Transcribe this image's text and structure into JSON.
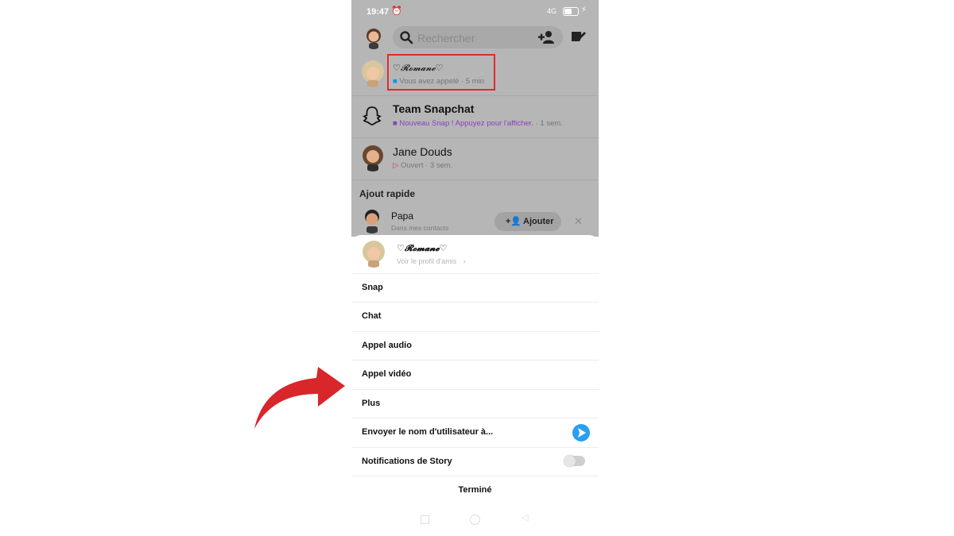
{
  "status_bar": {
    "time": "19:47",
    "signal": "4G",
    "battery_percent": 50
  },
  "search": {
    "placeholder": "Rechercher"
  },
  "chats": [
    {
      "name": "♡𝓡𝓸𝓶𝓪𝓷𝓮♡",
      "status": "Vous avez appelé",
      "time": "5 min",
      "status_icon": "video-call-icon",
      "status_color": "#1d8fe0"
    },
    {
      "name": "Team Snapchat",
      "status": "Nouveau Snap ! Appuyez pour l'afficher.",
      "time": "1 sem.",
      "status_icon": "new-snap-square-icon",
      "status_color": "#8a3fbf"
    },
    {
      "name": "Jane Douds",
      "status": "Ouvert",
      "time": "3 sem.",
      "status_icon": "opened-arrow-icon",
      "status_color": "#e0394a"
    }
  ],
  "quick_add": {
    "title": "Ajout rapide",
    "items": [
      {
        "name": "Papa",
        "subtitle": "Dans mes contacts",
        "add_label": "Ajouter"
      }
    ]
  },
  "sheet": {
    "profile_name": "♡𝓡𝓸𝓶𝓪𝓷𝓮♡",
    "profile_link": "Voir le profil d'amis",
    "items": {
      "snap": "Snap",
      "chat": "Chat",
      "audio": "Appel audio",
      "video": "Appel vidéo",
      "more": "Plus",
      "send_username": "Envoyer le nom d'utilisateur à...",
      "story_notifications": "Notifications de Story",
      "done": "Terminé"
    },
    "story_notifications_on": false
  },
  "colors": {
    "accent_red": "#e02b2b",
    "send_blue": "#2a9ff0",
    "overlay_gray": "#b6b6b6"
  }
}
